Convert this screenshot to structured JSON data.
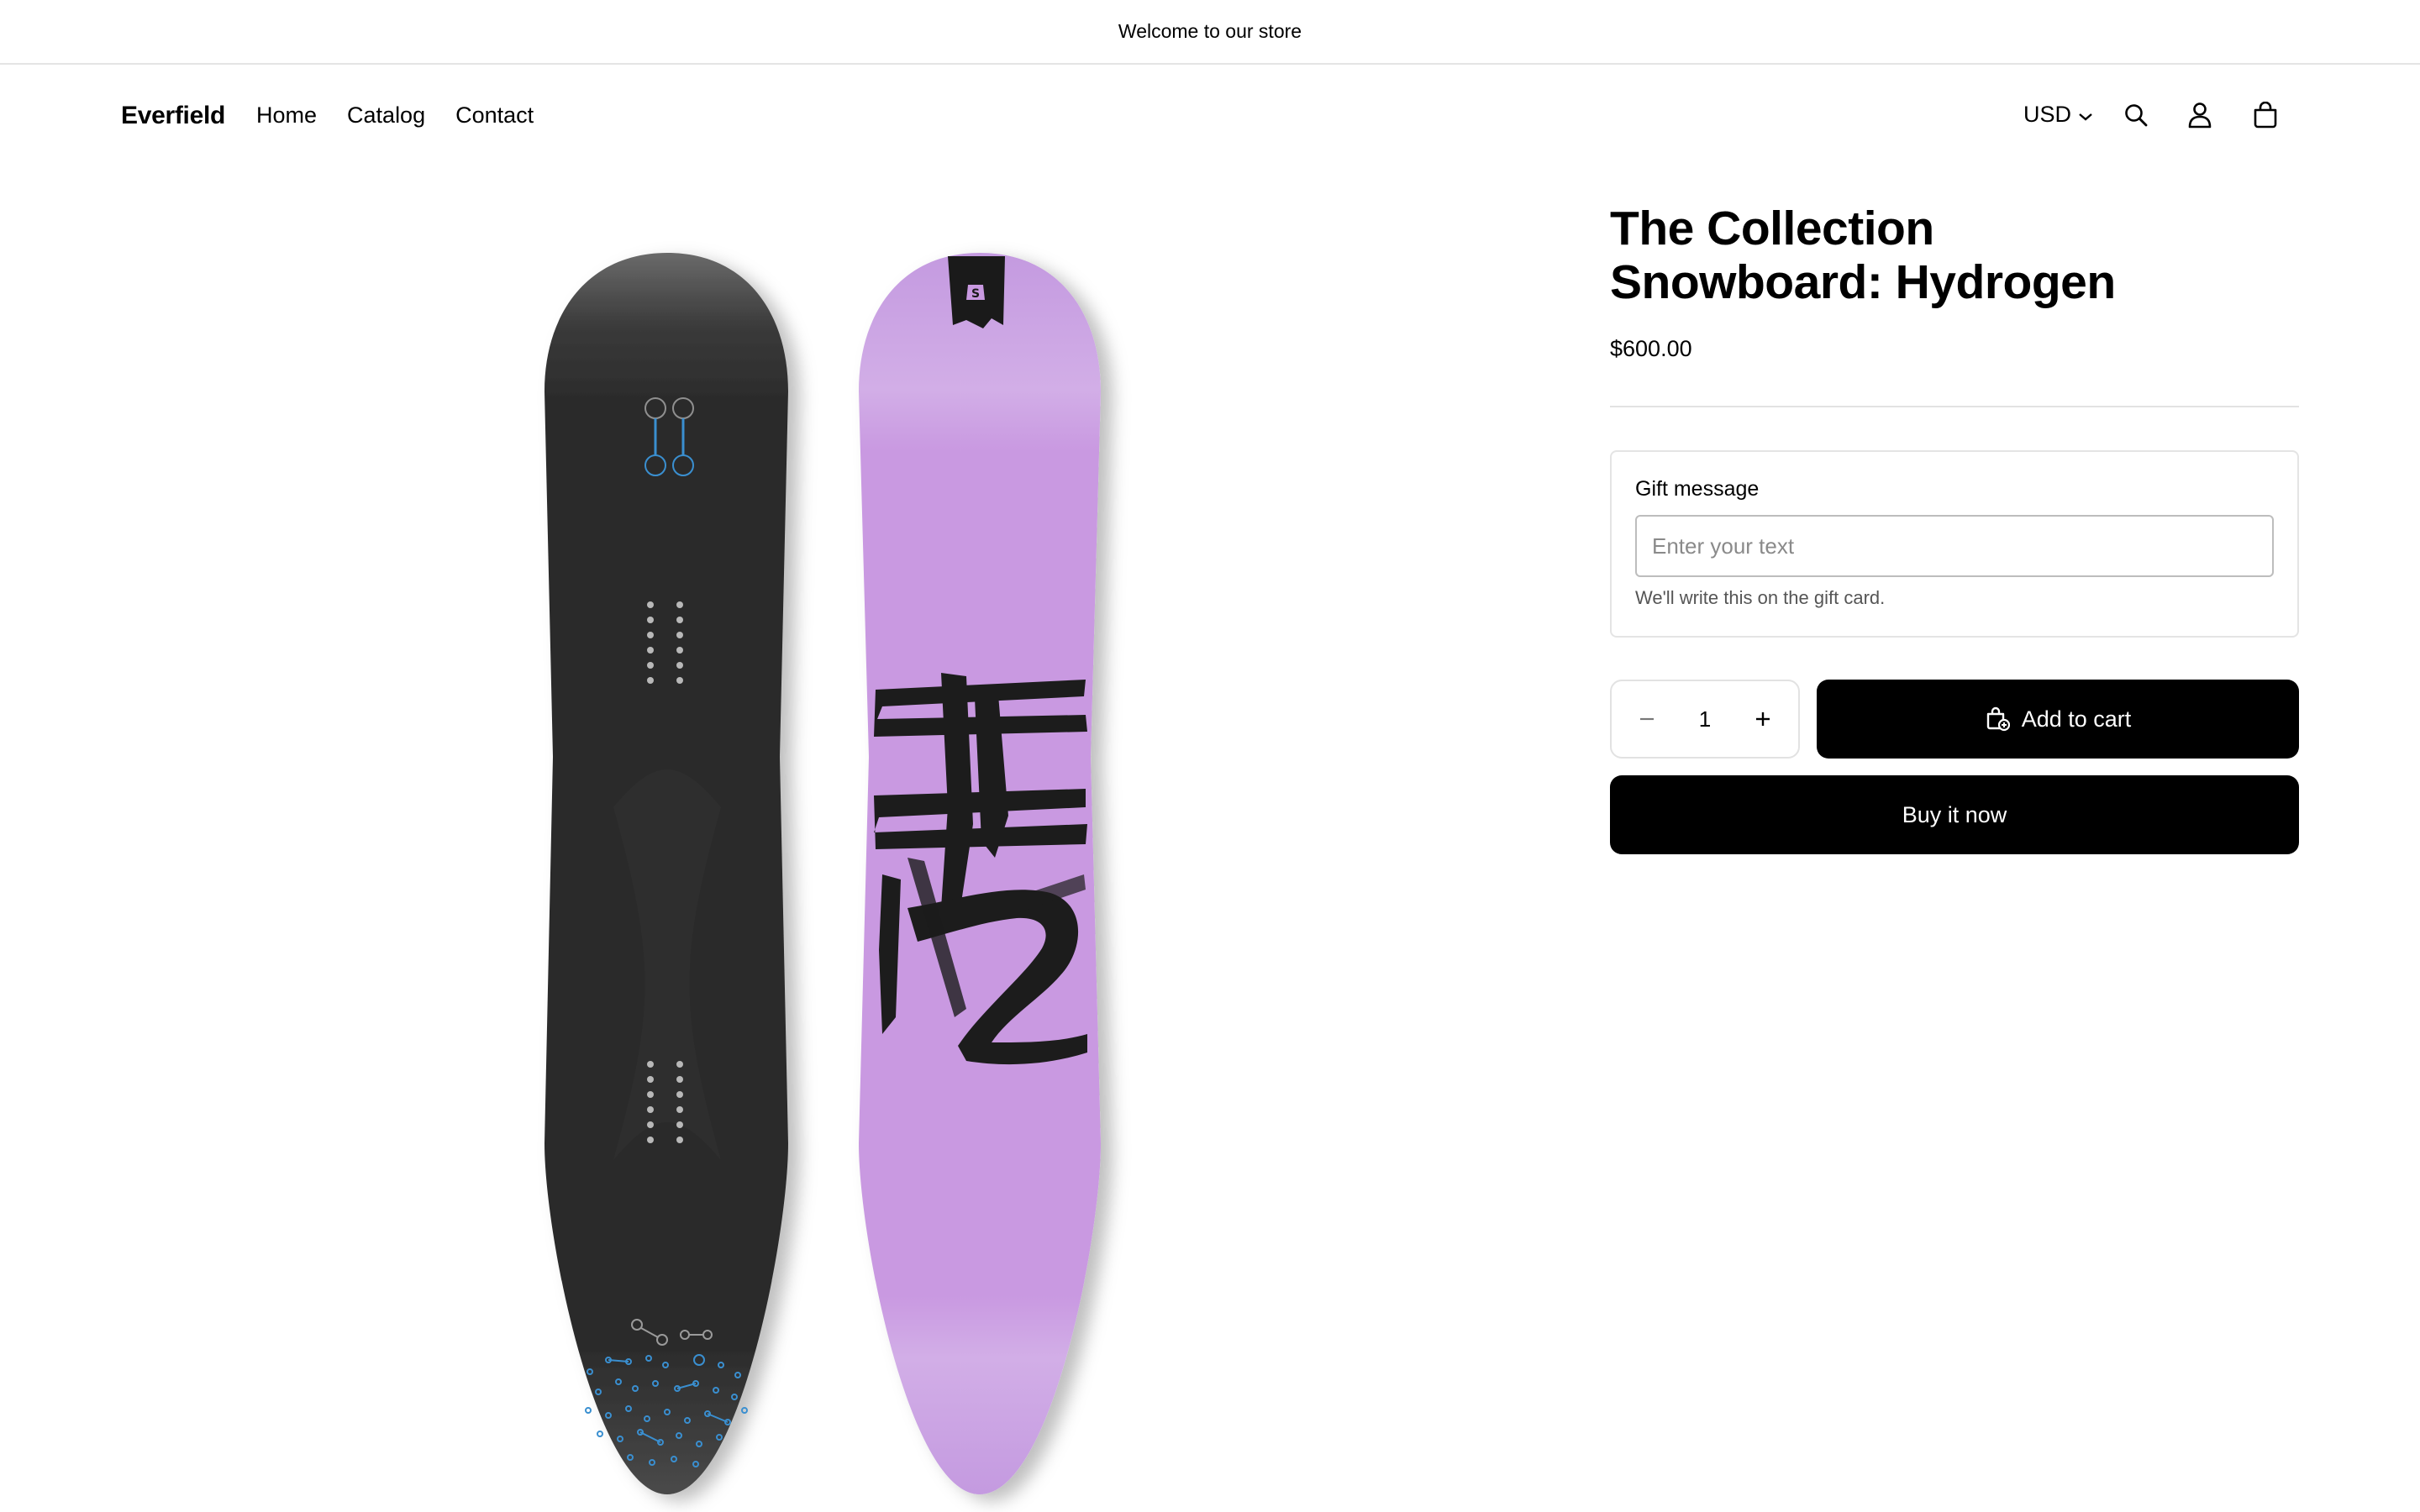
{
  "announcement": {
    "text": "Welcome to our store"
  },
  "header": {
    "logo": "Everfield",
    "nav": [
      "Home",
      "Catalog",
      "Contact"
    ],
    "currency": "USD",
    "icons": [
      "search-icon",
      "account-icon",
      "cart-icon"
    ]
  },
  "product": {
    "title_line1": "The Collection",
    "title_line2": "Snowboard: Hydrogen",
    "price": "$600.00",
    "gift": {
      "label": "Gift message",
      "placeholder": "Enter your text",
      "help": "We'll write this on the gift card."
    },
    "quantity": "1",
    "add_to_cart": "Add to cart",
    "buy_now": "Buy it now"
  },
  "images": [
    {
      "name": "snowboard-base",
      "color": "#2d2d2d",
      "accent": "#3a8fd0"
    },
    {
      "name": "snowboard-top",
      "color": "#c999e1",
      "accent": "#1a1a1a",
      "text": "H2"
    }
  ]
}
